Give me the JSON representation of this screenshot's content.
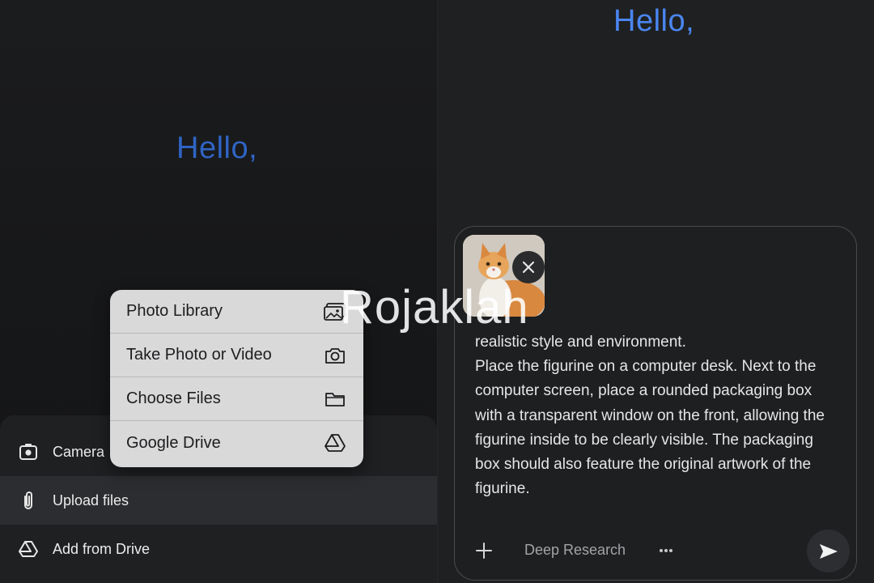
{
  "left": {
    "greeting": "Hello,",
    "sheet": {
      "items": [
        {
          "label": "Camera",
          "icon": "camera-icon"
        },
        {
          "label": "Upload files",
          "icon": "paperclip-icon"
        },
        {
          "label": "Add from Drive",
          "icon": "drive-icon"
        }
      ]
    },
    "menu": {
      "items": [
        {
          "label": "Photo Library",
          "icon": "photo-library-icon"
        },
        {
          "label": "Take Photo or Video",
          "icon": "camera-icon"
        },
        {
          "label": "Choose Files",
          "icon": "folder-icon"
        },
        {
          "label": "Google Drive",
          "icon": "drive-icon"
        }
      ]
    }
  },
  "right": {
    "greeting": "Hello,",
    "composer": {
      "prompt": "realistic style and environment.\nPlace the figurine on a computer desk. Next to the computer screen, place a rounded packaging box with a transparent window on the front, allowing the figurine inside to be clearly visible. The packaging box should also feature the original artwork of the figurine.",
      "deep_research_label": "Deep Research",
      "attachment": "cat-photo-thumbnail"
    }
  },
  "watermark": "Rojaklah",
  "colors": {
    "accent": "#4a86f0",
    "menu_bg": "#d9d9da",
    "sheet_bg": "#1f2022"
  }
}
